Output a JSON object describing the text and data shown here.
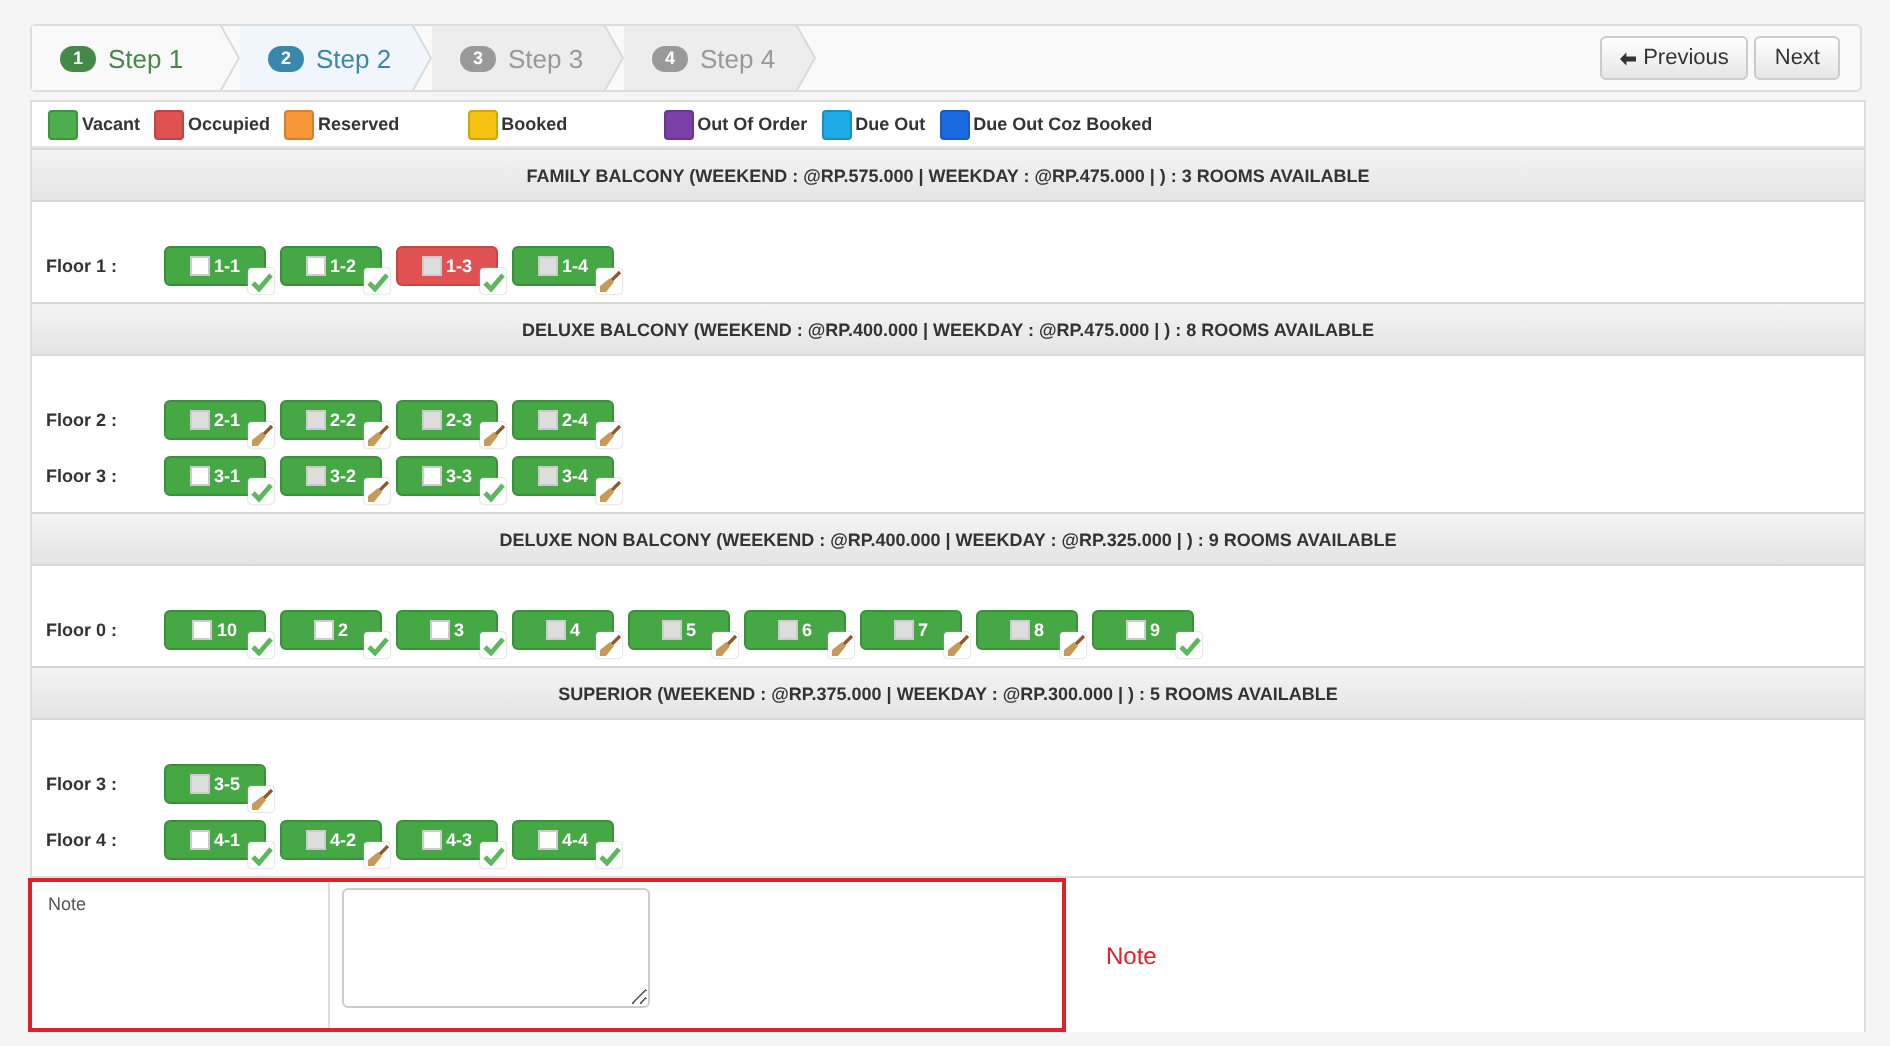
{
  "steps": [
    {
      "number": "1",
      "label": "Step 1",
      "selected": false,
      "completed": true
    },
    {
      "number": "2",
      "label": "Step 2",
      "selected": true,
      "completed": false
    },
    {
      "number": "3",
      "label": "Step 3",
      "selected": false,
      "completed": false
    },
    {
      "number": "4",
      "label": "Step 4",
      "selected": false,
      "completed": false
    }
  ],
  "nav_buttons": [
    {
      "label": "Previous",
      "kind": "back"
    },
    {
      "label": "Next",
      "kind": "plain"
    }
  ],
  "legend": [
    {
      "label": "Vacant",
      "color": "#4cae4c"
    },
    {
      "label": "Occupied",
      "color": "#e05252"
    },
    {
      "label": "Reserved",
      "color": "#f7973a"
    },
    {
      "label": "Booked",
      "color": "#f5c211"
    },
    {
      "label": "Out Of Order",
      "color": "#7b3fa8"
    },
    {
      "label": "Due Out",
      "color": "#1eaae7"
    },
    {
      "label": "Due Out Coz Booked",
      "color": "#1a6be0"
    }
  ],
  "sections": [
    {
      "title": "FAMILY BALCONY (WEEKEND : @RP.575.000 | WEEKDAY : @RP.475.000 | ) : 3 ROOMS AVAILABLE",
      "floors": [
        {
          "label": "Floor 1 :",
          "rooms": [
            {
              "name": "1-1",
              "occupied": false,
              "disabled": false,
              "clean": true
            },
            {
              "name": "1-2",
              "occupied": false,
              "disabled": false,
              "clean": true
            },
            {
              "name": "1-3",
              "occupied": true,
              "disabled": true,
              "clean": true
            },
            {
              "name": "1-4",
              "occupied": false,
              "disabled": true,
              "clean": false
            }
          ]
        }
      ]
    },
    {
      "title": "DELUXE BALCONY (WEEKEND : @RP.400.000 | WEEKDAY : @RP.475.000 | ) : 8 ROOMS AVAILABLE",
      "floors": [
        {
          "label": "Floor 2 :",
          "rooms": [
            {
              "name": "2-1",
              "occupied": false,
              "disabled": true,
              "clean": false
            },
            {
              "name": "2-2",
              "occupied": false,
              "disabled": true,
              "clean": false
            },
            {
              "name": "2-3",
              "occupied": false,
              "disabled": true,
              "clean": false
            },
            {
              "name": "2-4",
              "occupied": false,
              "disabled": true,
              "clean": false
            }
          ]
        },
        {
          "label": "Floor 3 :",
          "rooms": [
            {
              "name": "3-1",
              "occupied": false,
              "disabled": false,
              "clean": true
            },
            {
              "name": "3-2",
              "occupied": false,
              "disabled": true,
              "clean": false
            },
            {
              "name": "3-3",
              "occupied": false,
              "disabled": false,
              "clean": true
            },
            {
              "name": "3-4",
              "occupied": false,
              "disabled": true,
              "clean": false
            }
          ]
        }
      ]
    },
    {
      "title": "DELUXE NON BALCONY (WEEKEND : @RP.400.000 | WEEKDAY : @RP.325.000 | ) : 9 ROOMS AVAILABLE",
      "floors": [
        {
          "label": "Floor 0 :",
          "rooms": [
            {
              "name": "10",
              "occupied": false,
              "disabled": false,
              "clean": true
            },
            {
              "name": "2",
              "occupied": false,
              "disabled": false,
              "clean": true
            },
            {
              "name": "3",
              "occupied": false,
              "disabled": false,
              "clean": true
            },
            {
              "name": "4",
              "occupied": false,
              "disabled": true,
              "clean": false
            },
            {
              "name": "5",
              "occupied": false,
              "disabled": true,
              "clean": false
            },
            {
              "name": "6",
              "occupied": false,
              "disabled": true,
              "clean": false
            },
            {
              "name": "7",
              "occupied": false,
              "disabled": true,
              "clean": false
            },
            {
              "name": "8",
              "occupied": false,
              "disabled": true,
              "clean": false
            },
            {
              "name": "9",
              "occupied": false,
              "disabled": false,
              "clean": true
            }
          ]
        }
      ]
    },
    {
      "title": "SUPERIOR (WEEKEND : @RP.375.000 | WEEKDAY : @RP.300.000 | ) : 5 ROOMS AVAILABLE",
      "floors": [
        {
          "label": "Floor 3 :",
          "rooms": [
            {
              "name": "3-5",
              "occupied": false,
              "disabled": true,
              "clean": false
            }
          ]
        },
        {
          "label": "Floor 4 :",
          "rooms": [
            {
              "name": "4-1",
              "occupied": false,
              "disabled": false,
              "clean": true
            },
            {
              "name": "4-2",
              "occupied": false,
              "disabled": true,
              "clean": false
            },
            {
              "name": "4-3",
              "occupied": false,
              "disabled": false,
              "clean": true
            },
            {
              "name": "4-4",
              "occupied": false,
              "disabled": false,
              "clean": true
            }
          ]
        }
      ]
    }
  ],
  "note": {
    "label": "Note",
    "hint": "Note"
  }
}
